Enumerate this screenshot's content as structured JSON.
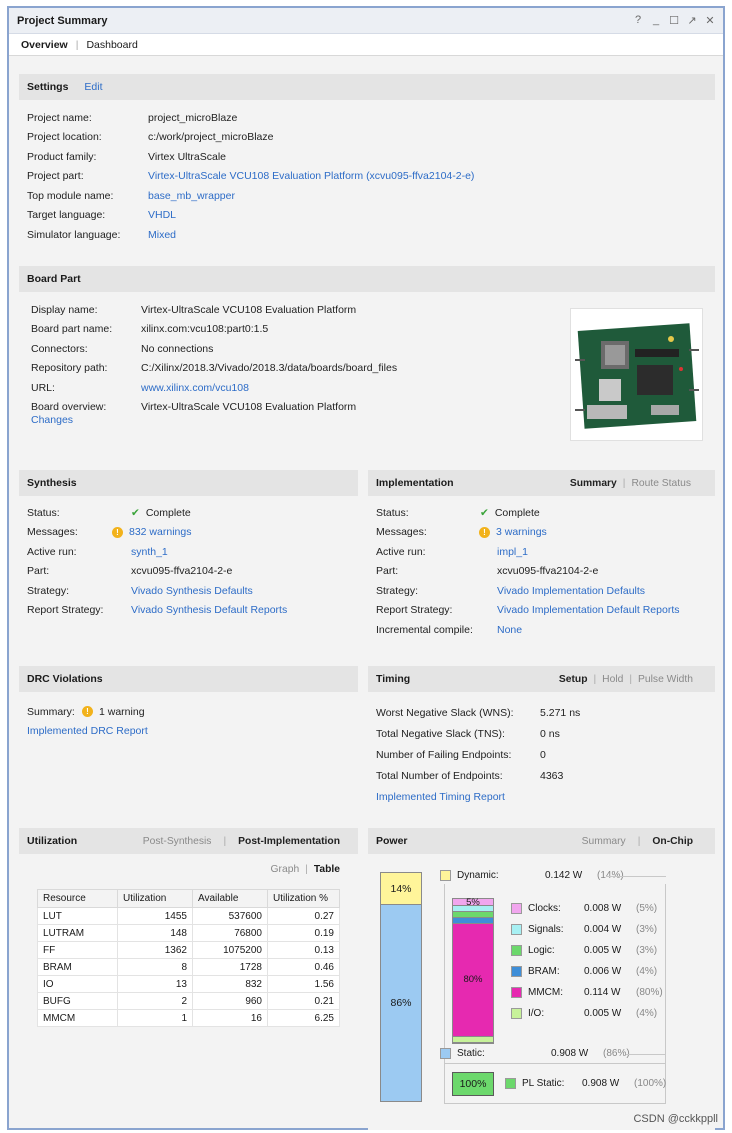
{
  "window": {
    "title": "Project Summary",
    "controls": [
      "?",
      "_",
      "☐",
      "↗",
      "✕"
    ]
  },
  "tabs": [
    {
      "label": "Overview",
      "active": true
    },
    {
      "label": "Dashboard",
      "active": false
    }
  ],
  "settings": {
    "title": "Settings",
    "edit": "Edit",
    "rows": [
      {
        "k": "Project name:",
        "v": "project_microBlaze",
        "link": false
      },
      {
        "k": "Project location:",
        "v": "c:/work/project_microBlaze",
        "link": false
      },
      {
        "k": "Product family:",
        "v": "Virtex UltraScale",
        "link": false
      },
      {
        "k": "Project part:",
        "v": "Virtex-UltraScale VCU108 Evaluation Platform (xcvu095-ffva2104-2-e)",
        "link": true
      },
      {
        "k": "Top module name:",
        "v": "base_mb_wrapper",
        "link": true
      },
      {
        "k": "Target language:",
        "v": "VHDL",
        "link": true
      },
      {
        "k": "Simulator language:",
        "v": "Mixed",
        "link": true
      }
    ]
  },
  "board": {
    "title": "Board Part",
    "rows": [
      {
        "k": "Display name:",
        "v": "Virtex-UltraScale VCU108 Evaluation Platform",
        "link": false
      },
      {
        "k": "Board part name:",
        "v": "xilinx.com:vcu108:part0:1.5",
        "link": false
      },
      {
        "k": "Connectors:",
        "v": "No connections",
        "link": false
      },
      {
        "k": "Repository path:",
        "v": "C:/Xilinx/2018.3/Vivado/2018.3/data/boards/board_files",
        "link": false
      },
      {
        "k": "URL:",
        "v": "www.xilinx.com/vcu108",
        "link": true
      },
      {
        "k": "Board overview:",
        "v": "Virtex-UltraScale VCU108 Evaluation Platform",
        "link": false
      }
    ],
    "changes": "Changes"
  },
  "synthesis": {
    "title": "Synthesis",
    "status_k": "Status:",
    "status_v": "Complete",
    "messages_k": "Messages:",
    "messages_v": "832 warnings",
    "rows": [
      {
        "k": "Active run:",
        "v": "synth_1",
        "link": true
      },
      {
        "k": "Part:",
        "v": "xcvu095-ffva2104-2-e",
        "link": false
      },
      {
        "k": "Strategy:",
        "v": "Vivado Synthesis Defaults",
        "link": true
      },
      {
        "k": "Report Strategy:",
        "v": "Vivado Synthesis Default Reports",
        "link": true
      }
    ]
  },
  "implementation": {
    "title": "Implementation",
    "tab_summary": "Summary",
    "tab_route": "Route Status",
    "status_k": "Status:",
    "status_v": "Complete",
    "messages_k": "Messages:",
    "messages_v": "3 warnings",
    "rows": [
      {
        "k": "Active run:",
        "v": "impl_1",
        "link": true
      },
      {
        "k": "Part:",
        "v": "xcvu095-ffva2104-2-e",
        "link": false
      },
      {
        "k": "Strategy:",
        "v": "Vivado Implementation Defaults",
        "link": true
      },
      {
        "k": "Report Strategy:",
        "v": "Vivado Implementation Default Reports",
        "link": true
      },
      {
        "k": "Incremental compile:",
        "v": "None",
        "link": true
      }
    ]
  },
  "drc": {
    "title": "DRC Violations",
    "summary_k": "Summary:",
    "summary_v": "1 warning",
    "report": "Implemented DRC Report"
  },
  "timing": {
    "title": "Timing",
    "tab_setup": "Setup",
    "tab_hold": "Hold",
    "tab_pulse": "Pulse Width",
    "rows": [
      {
        "k": "Worst Negative Slack (WNS):",
        "v": "5.271 ns"
      },
      {
        "k": "Total Negative Slack (TNS):",
        "v": "0 ns"
      },
      {
        "k": "Number of Failing Endpoints:",
        "v": "0"
      },
      {
        "k": "Total Number of Endpoints:",
        "v": "4363"
      }
    ],
    "report": "Implemented Timing Report"
  },
  "utilization": {
    "title": "Utilization",
    "tab_post_synth": "Post-Synthesis",
    "tab_post_impl": "Post-Implementation",
    "view_graph": "Graph",
    "view_table": "Table",
    "headers": [
      "Resource",
      "Utilization",
      "Available",
      "Utilization %"
    ],
    "rows": [
      [
        "LUT",
        "1455",
        "537600",
        "0.27"
      ],
      [
        "LUTRAM",
        "148",
        "76800",
        "0.19"
      ],
      [
        "FF",
        "1362",
        "1075200",
        "0.13"
      ],
      [
        "BRAM",
        "8",
        "1728",
        "0.46"
      ],
      [
        "IO",
        "13",
        "832",
        "1.56"
      ],
      [
        "BUFG",
        "2",
        "960",
        "0.21"
      ],
      [
        "MMCM",
        "1",
        "16",
        "6.25"
      ]
    ]
  },
  "power": {
    "title": "Power",
    "tab_summary": "Summary",
    "tab_onchip": "On-Chip",
    "bar_dynamic_pct": "14%",
    "bar_static_pct": "86%",
    "dynamic": {
      "label": "Dynamic:",
      "value": "0.142 W",
      "pct": "(14%)",
      "color": "#fff59a",
      "fraction": 0.14
    },
    "static": {
      "label": "Static:",
      "value": "0.908 W",
      "pct": "(86%)",
      "color": "#9ccaf2",
      "fraction": 0.86
    },
    "dyn_bar_labels": {
      "clocks": "5%",
      "mmcm": "80%"
    },
    "dyn_items": [
      {
        "label": "Clocks:",
        "value": "0.008 W",
        "pct": "(5%)",
        "color": "#f1a6ee",
        "fraction": 0.05
      },
      {
        "label": "Signals:",
        "value": "0.004 W",
        "pct": "(3%)",
        "color": "#a7f0f3",
        "fraction": 0.03
      },
      {
        "label": "Logic:",
        "value": "0.005 W",
        "pct": "(3%)",
        "color": "#6cd86c",
        "fraction": 0.03
      },
      {
        "label": "BRAM:",
        "value": "0.006 W",
        "pct": "(4%)",
        "color": "#3e8ed8",
        "fraction": 0.04
      },
      {
        "label": "MMCM:",
        "value": "0.114 W",
        "pct": "(80%)",
        "color": "#e629b0",
        "fraction": 0.8
      },
      {
        "label": "I/O:",
        "value": "0.005 W",
        "pct": "(4%)",
        "color": "#c7f29a",
        "fraction": 0.04
      }
    ],
    "pl_static": {
      "label": "PL Static:",
      "value": "0.908 W",
      "pct": "(100%)",
      "bar_label": "100%",
      "color": "#6cd86c"
    }
  },
  "watermark": "CSDN @cckkppll"
}
